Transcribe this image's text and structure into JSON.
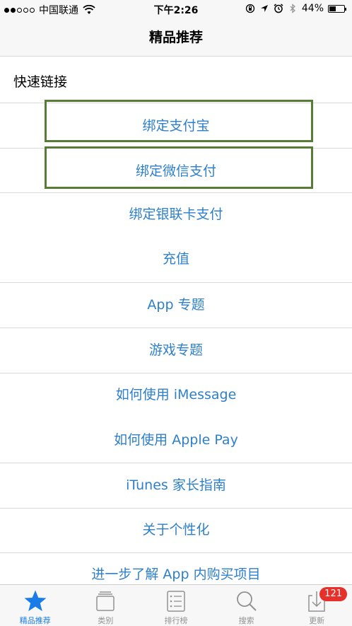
{
  "status_bar": {
    "carrier": "中国联通",
    "time": "下午2:26",
    "battery": "44%",
    "battery_level": 0.44
  },
  "nav": {
    "title": "精品推荐"
  },
  "section": {
    "title": "快速链接"
  },
  "links": [
    "绑定支付宝",
    "绑定微信支付",
    "绑定银联卡支付",
    "充值",
    "App 专题",
    "游戏专题",
    "如何使用 iMessage",
    "如何使用 Apple Pay",
    "iTunes 家长指南",
    "关于个性化",
    "进一步了解 App 内购买项目"
  ],
  "tabs": [
    {
      "label": "精品推荐",
      "icon": "star-icon",
      "active": true
    },
    {
      "label": "类别",
      "icon": "categories-icon",
      "active": false
    },
    {
      "label": "排行榜",
      "icon": "top-charts-icon",
      "active": false
    },
    {
      "label": "搜索",
      "icon": "search-icon",
      "active": false
    },
    {
      "label": "更新",
      "icon": "updates-icon",
      "active": false,
      "badge": "121"
    }
  ],
  "colors": {
    "link": "#2d7fcb",
    "active_tab": "#1a7ce8",
    "inactive_tab": "#929292",
    "highlight": "#567c35",
    "badge": "#e8302b"
  }
}
